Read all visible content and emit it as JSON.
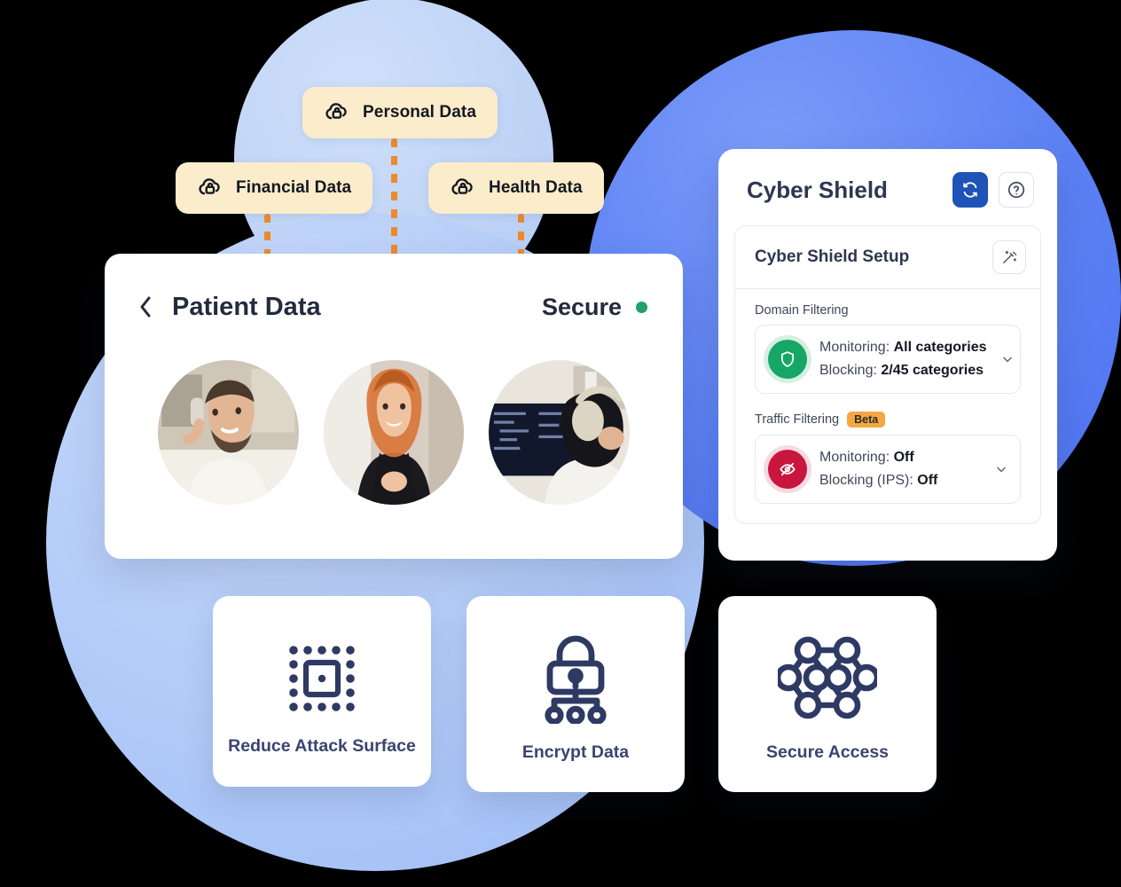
{
  "background": {
    "light_circle_color": "#c0d4f6",
    "large_circle_color": "#b5cdf8",
    "blue_circle_color": "#5d82f4"
  },
  "data_pills": [
    {
      "label": "Personal Data",
      "icon": "cloud-lock-icon"
    },
    {
      "label": "Financial Data",
      "icon": "cloud-lock-icon"
    },
    {
      "label": "Health Data",
      "icon": "cloud-lock-icon"
    }
  ],
  "connector_color": "#ed8a2e",
  "patient_card": {
    "back_icon": "chevron-left-icon",
    "title": "Patient Data",
    "status_label": "Secure",
    "status_color": "#22a06b",
    "avatars": [
      {
        "name": "avatar-man-on-phone"
      },
      {
        "name": "avatar-woman-smiling"
      },
      {
        "name": "avatar-developer-headphones"
      }
    ]
  },
  "shield_panel": {
    "title": "Cyber Shield",
    "refresh_icon": "refresh-sync-icon",
    "help_icon": "question-circle-icon",
    "accent_color": "#1e54b7",
    "setup": {
      "title": "Cyber Shield Setup",
      "wand_icon": "magic-wand-icon",
      "sections": [
        {
          "label": "Domain Filtering",
          "badge": null,
          "status_icon": "shield-icon",
          "status_color": "#16a766",
          "line1_prefix": "Monitoring: ",
          "line1_value": "All categories",
          "line2_prefix": "Blocking: ",
          "line2_value": "2/45 categories",
          "chevron": "chevron-down-icon"
        },
        {
          "label": "Traffic Filtering",
          "badge": "Beta",
          "status_icon": "eye-off-icon",
          "status_color": "#c8163f",
          "line1_prefix": "Monitoring: ",
          "line1_value": "Off",
          "line2_prefix": "Blocking (IPS): ",
          "line2_value": "Off",
          "chevron": "chevron-down-icon"
        }
      ]
    }
  },
  "features": [
    {
      "label": "Reduce Attack Surface",
      "icon": "attack-surface-grid-icon"
    },
    {
      "label": "Encrypt Data",
      "icon": "lock-network-icon"
    },
    {
      "label": "Secure Access",
      "icon": "mesh-network-icon"
    }
  ]
}
